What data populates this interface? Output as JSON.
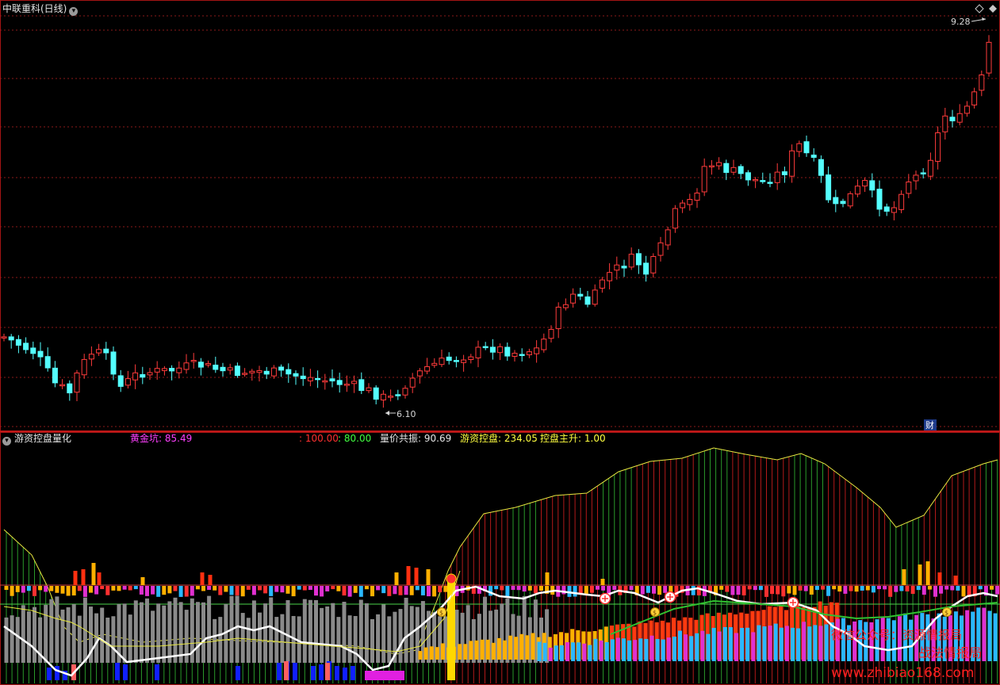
{
  "main_chart": {
    "title": "中联重科(日线)",
    "menu_icon": "chevron-down-icon",
    "settings_icon": "diamond-icon",
    "high_label": "9.28",
    "low_label": "6.10",
    "fin_badge": "财",
    "up_color": "#ff3b3b",
    "down_color": "#54ffff",
    "grid_color": "#8b1a1a"
  },
  "indicator": {
    "name": "游资控盘量化",
    "menu_icon": "chevron-down-icon",
    "gold_label": "黄金坑:",
    "gold_value": "85.49",
    "level_red": ": 100.00",
    "level_green": ": 80.00",
    "resonance_label": "量价共振:",
    "resonance_value": "90.69",
    "control_label": "游资控盘:",
    "control_value": "234.05",
    "rise_label": "控盘主升:",
    "rise_value": "1.00"
  },
  "watermarks": {
    "wechat": "微信公众号：资源情报局",
    "bureau": "战法情报局",
    "site": "www.zhibiao168.com"
  }
}
